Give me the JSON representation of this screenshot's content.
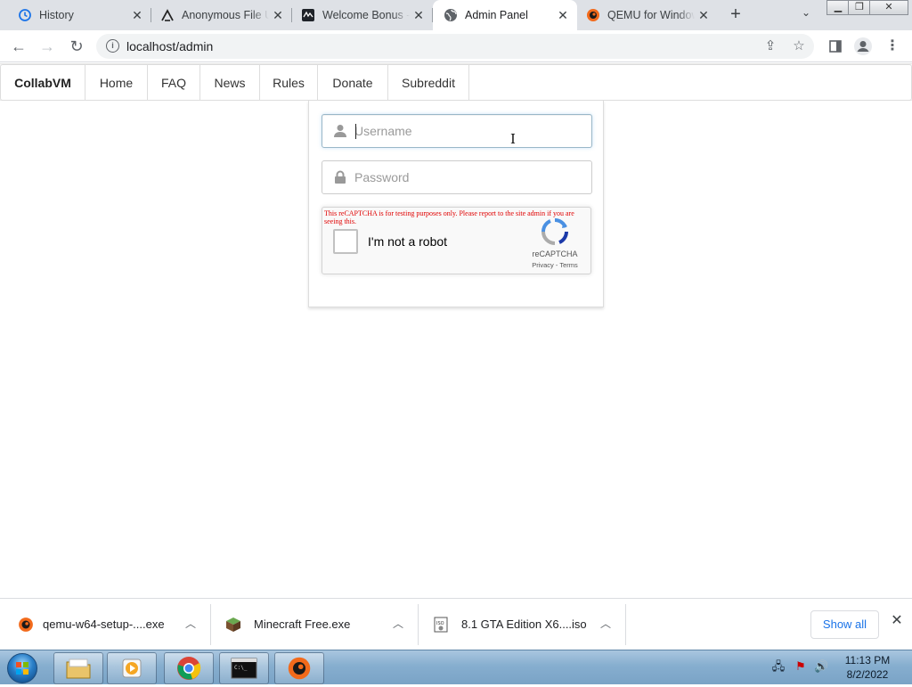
{
  "browser": {
    "tabs": [
      {
        "title": "History",
        "icon": "history-icon",
        "active": false
      },
      {
        "title": "Anonymous File Upload",
        "icon": "upload-site-icon",
        "active": false
      },
      {
        "title": "Welcome Bonus - Casino",
        "icon": "casino-site-icon",
        "active": false
      },
      {
        "title": "Admin Panel",
        "icon": "globe-icon",
        "active": true
      },
      {
        "title": "QEMU for Windows",
        "icon": "qemu-icon",
        "active": false
      }
    ],
    "new_tab": "+",
    "window_controls": [
      "minimize",
      "restore",
      "close"
    ],
    "address": "localhost/admin"
  },
  "site": {
    "brand": "CollabVM",
    "nav": [
      "Home",
      "FAQ",
      "News",
      "Rules",
      "Donate",
      "Subreddit"
    ]
  },
  "login": {
    "username_placeholder": "Username",
    "password_placeholder": "Password"
  },
  "recaptcha": {
    "warning": "This reCAPTCHA is for testing purposes only. Please report to the site admin if you are seeing this.",
    "checkbox_label": "I'm not a robot",
    "brand": "reCAPTCHA",
    "links": "Privacy - Terms"
  },
  "downloads": {
    "items": [
      {
        "name": "qemu-w64-setup-....exe",
        "icon": "qemu-icon"
      },
      {
        "name": "Minecraft Free.exe",
        "icon": "minecraft-icon"
      },
      {
        "name": "8.1 GTA Edition X6....iso",
        "icon": "iso-file-icon"
      }
    ],
    "show_all": "Show all"
  },
  "taskbar": {
    "apps": [
      "file-explorer-icon",
      "media-player-icon",
      "chrome-icon",
      "command-prompt-icon",
      "qemu-icon"
    ],
    "time": "11:13 PM",
    "date": "8/2/2022"
  },
  "colors": {
    "tabstrip": "#dee1e6",
    "link": "#1a73e8",
    "captcha_warning": "#e00000"
  }
}
